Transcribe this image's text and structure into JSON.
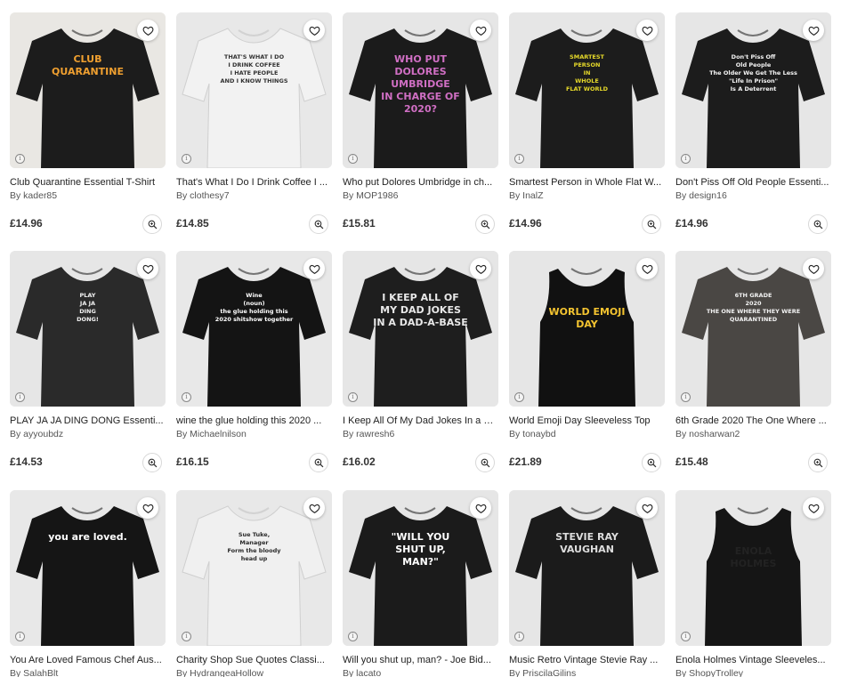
{
  "products": [
    {
      "title": "Club Quarantine Essential T-Shirt",
      "artist": "By kader85",
      "price": "£14.96",
      "bg": "#e9e7e3",
      "shirt": "#1c1c1c",
      "print_lines": [
        "CLUB",
        "QUARANTINE"
      ],
      "print_color": "#f0a030"
    },
    {
      "title": "That's What I Do I Drink Coffee I ...",
      "artist": "By clothesy7",
      "price": "£14.85",
      "bg": "#e8e8e8",
      "shirt": "#f2f2f2",
      "print_lines": [
        "THAT'S WHAT I DO",
        "I DRINK COFFEE",
        "I HATE PEOPLE",
        "AND I KNOW THINGS"
      ],
      "print_color": "#333333"
    },
    {
      "title": "Who put Dolores Umbridge in ch...",
      "artist": "By MOP1986",
      "price": "£15.81",
      "bg": "#e6e6e6",
      "shirt": "#1b1b1b",
      "print_lines": [
        "WHO PUT",
        "DOLORES UMBRIDGE",
        "IN CHARGE OF 2020?"
      ],
      "print_color": "#d06fc4"
    },
    {
      "title": "Smartest Person in Whole Flat W...",
      "artist": "By InalZ",
      "price": "£14.96",
      "bg": "#e6e6e6",
      "shirt": "#1c1c1c",
      "print_lines": [
        "SMARTEST",
        "PERSON",
        "IN",
        "WHOLE",
        "FLAT WORLD"
      ],
      "print_color": "#e6d92a"
    },
    {
      "title": "Don't Piss Off Old People Essenti...",
      "artist": "By design16",
      "price": "£14.96",
      "bg": "#e6e6e6",
      "shirt": "#1c1c1c",
      "print_lines": [
        "Don't Piss Off",
        "Old People",
        "The Older We Get The Less",
        "\"Life In Prison\"",
        "Is A Deterrent"
      ],
      "print_color": "#f5f5f5"
    },
    {
      "title": "PLAY JA JA DING DONG Essenti...",
      "artist": "By ayyoubdz",
      "price": "£14.53",
      "bg": "#e6e6e6",
      "shirt": "#2a2a2a",
      "print_lines": [
        "PLAY",
        "JA JA",
        "DING",
        "DONG!"
      ],
      "print_color": "#f2f2f2"
    },
    {
      "title": "wine the glue holding this 2020 ...",
      "artist": "By Michaelnilson",
      "price": "£16.15",
      "bg": "#e8e8e8",
      "shirt": "#141414",
      "print_lines": [
        "Wine",
        "(noun)",
        "the glue holding this",
        "2020 shitshow together"
      ],
      "print_color": "#ffffff"
    },
    {
      "title": "I Keep All Of My Dad Jokes In a D...",
      "artist": "By rawresh6",
      "price": "£16.02",
      "bg": "#e6e6e6",
      "shirt": "#1e1e1e",
      "print_lines": [
        "I KEEP ALL OF",
        "MY DAD JOKES",
        "IN A DAD-A-BASE"
      ],
      "print_color": "#e8e8e8"
    },
    {
      "title": "World Emoji Day Sleeveless Top",
      "artist": "By tonaybd",
      "price": "£21.89",
      "bg": "#e6e6e6",
      "shirt": "#111111",
      "print_lines": [
        "WORLD EMOJI DAY"
      ],
      "print_color": "#f4c430"
    },
    {
      "title": "6th Grade 2020 The One Where ...",
      "artist": "By nosharwan2",
      "price": "£15.48",
      "bg": "#e6e6e6",
      "shirt": "#4a4744",
      "print_lines": [
        "6TH GRADE",
        "2020",
        "THE ONE WHERE THEY WERE",
        "QUARANTINED"
      ],
      "print_color": "#f2f2f2"
    },
    {
      "title": "You Are Loved Famous Chef Aus...",
      "artist": "By SalahBlt",
      "price": "",
      "bg": "#e8e8e8",
      "shirt": "#151515",
      "print_lines": [
        "you are loved."
      ],
      "print_color": "#ffffff"
    },
    {
      "title": "Charity Shop Sue Quotes Classi...",
      "artist": "By HydrangeaHollow",
      "price": "",
      "bg": "#e8e8e8",
      "shirt": "#f0f0f0",
      "print_lines": [
        "Sue Tuke,",
        "Manager",
        "Form the bloody",
        "head up"
      ],
      "print_color": "#2a2a2a"
    },
    {
      "title": "Will you shut up, man? - Joe Bid...",
      "artist": "By lacato",
      "price": "",
      "bg": "#e6e6e6",
      "shirt": "#1b1b1b",
      "print_lines": [
        "\"WILL YOU",
        "SHUT UP,",
        "MAN?\""
      ],
      "print_color": "#ffffff"
    },
    {
      "title": "Music Retro Vintage Stevie Ray ...",
      "artist": "By PriscilaGilins",
      "price": "",
      "bg": "#e6e6e6",
      "shirt": "#1b1b1b",
      "print_lines": [
        "STEVIE RAY VAUGHAN"
      ],
      "print_color": "#dddddd"
    },
    {
      "title": "Enola Holmes Vintage Sleeveles...",
      "artist": "By ShopyTrolley",
      "price": "",
      "bg": "#e8e8e8",
      "shirt": "#151515",
      "print_lines": [
        "ENOLA",
        "HOLMES"
      ],
      "print_color": "#222222"
    }
  ],
  "icons": {
    "favorite": "heart-icon",
    "zoom": "zoom-in-icon",
    "info": "info-icon"
  }
}
